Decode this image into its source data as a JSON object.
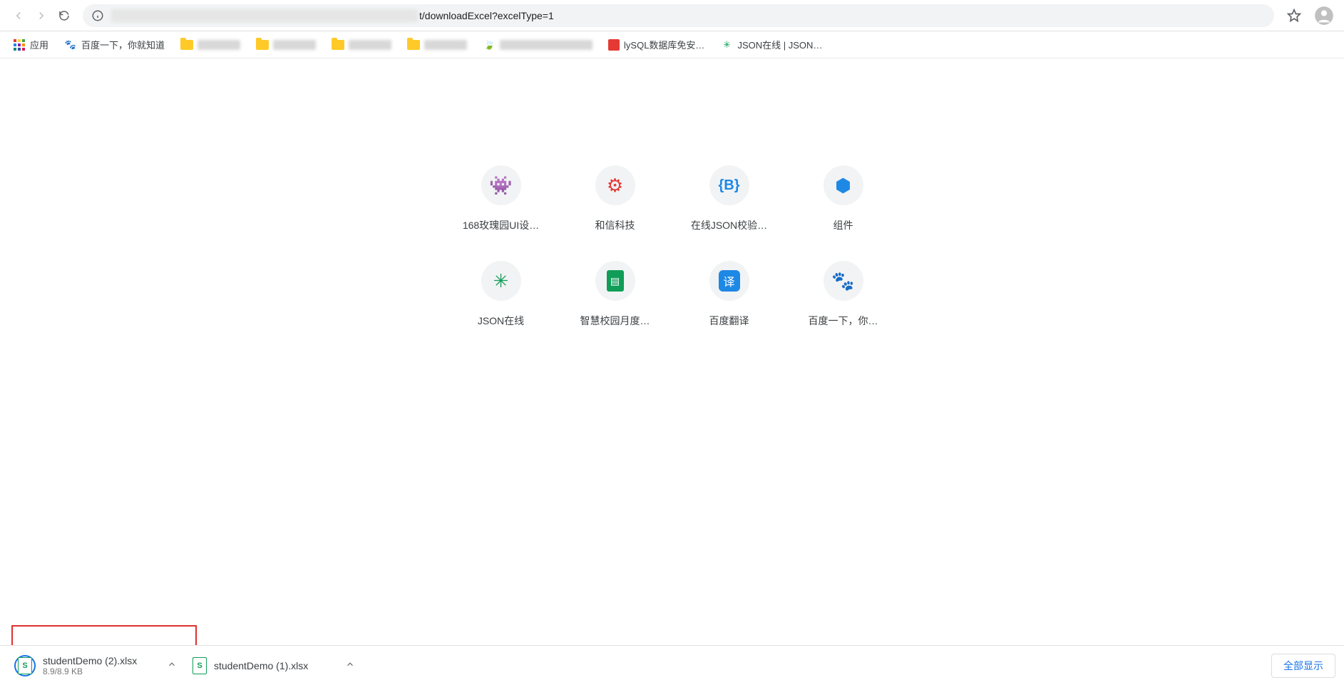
{
  "address": {
    "visible_path": "t/downloadExcel?excelType=1"
  },
  "bookmarks": {
    "apps_label": "应用",
    "baidu_label": "百度一下，你就知道",
    "mysql_label": "lySQL数据库免安…",
    "json_label": "JSON在线 | JSON…"
  },
  "shortcuts": [
    {
      "label": "168玫瑰园UI设…",
      "icon_name": "monster-icon",
      "icon_color": "#1e88e5"
    },
    {
      "label": "和信科技",
      "icon_name": "gear-icon",
      "icon_color": "#e53935"
    },
    {
      "label": "在线JSON校验…",
      "icon_name": "code-icon",
      "icon_color": "#1e88e5"
    },
    {
      "label": "组件",
      "icon_name": "cube-icon",
      "icon_color": "#1e88e5"
    },
    {
      "label": "JSON在线",
      "icon_name": "puzzle-icon",
      "icon_color": "#0f9d58"
    },
    {
      "label": "智慧校园月度…",
      "icon_name": "sheet-icon",
      "icon_color": "#0f9d58"
    },
    {
      "label": "百度翻译",
      "icon_name": "translate-icon",
      "icon_color": "#1e88e5"
    },
    {
      "label": "百度一下，你…",
      "icon_name": "baidu-icon",
      "icon_color": "#2962ff"
    }
  ],
  "downloads": {
    "items": [
      {
        "name": "studentDemo (2).xlsx",
        "sub": "8.9/8.9 KB"
      },
      {
        "name": "studentDemo (1).xlsx",
        "sub": ""
      }
    ],
    "show_all": "全部显示"
  }
}
